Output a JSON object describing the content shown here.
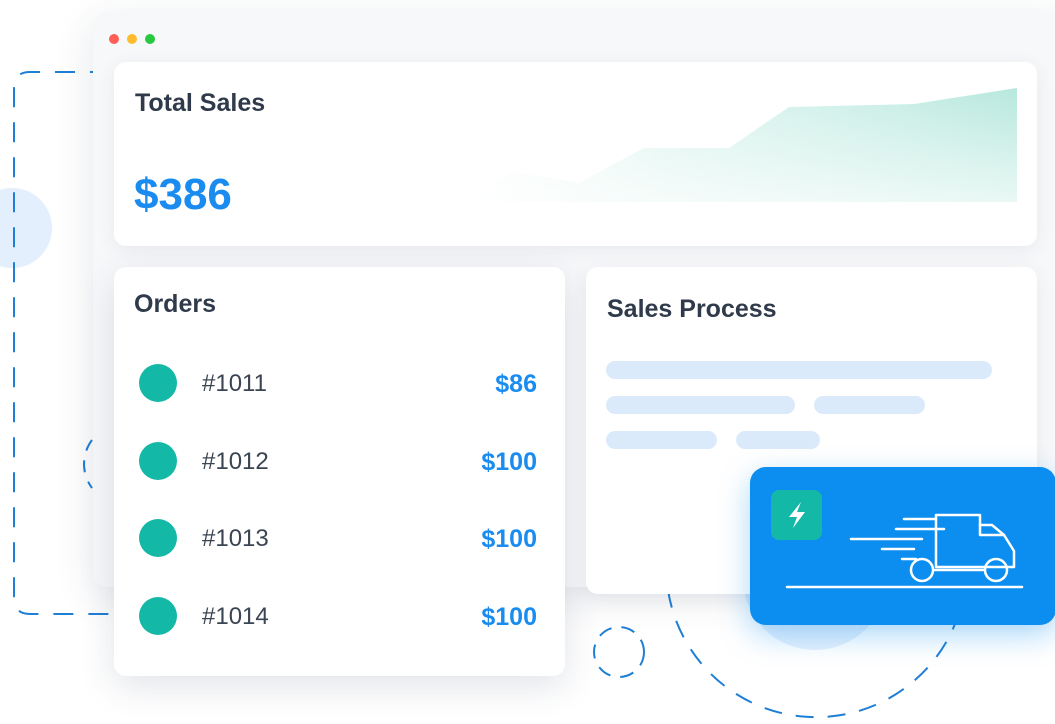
{
  "sales": {
    "title": "Total Sales",
    "value": "$386"
  },
  "orders": {
    "title": "Orders",
    "items": [
      {
        "id": "#1011",
        "amount": "$86"
      },
      {
        "id": "#1012",
        "amount": "$100"
      },
      {
        "id": "#1013",
        "amount": "$100"
      },
      {
        "id": "#1014",
        "amount": "$100"
      }
    ]
  },
  "process": {
    "title": "Sales Process"
  },
  "icons": {
    "bolt": "lightning-bolt-icon",
    "truck": "delivery-truck-icon"
  },
  "colors": {
    "accent": "#1a8cf0",
    "teal": "#14b8a6",
    "truck_card": "#0b8ef0",
    "window_dots": [
      "#ff5f57",
      "#febc2e",
      "#28c840"
    ]
  }
}
